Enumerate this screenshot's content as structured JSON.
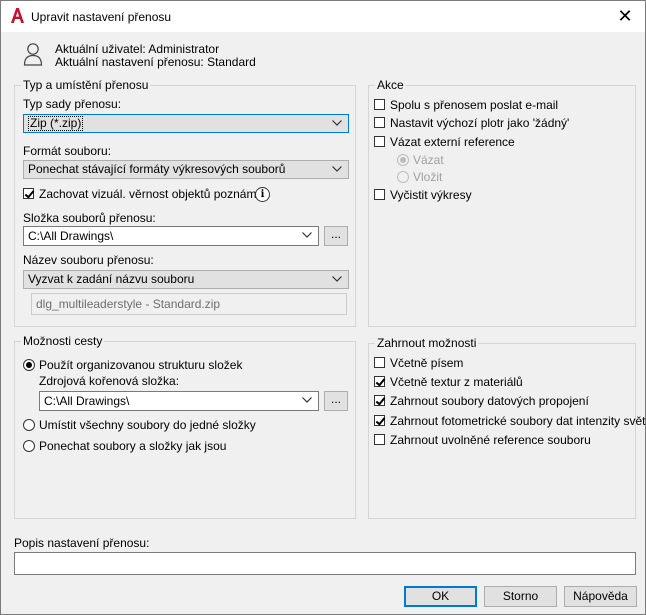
{
  "window": {
    "title": "Upravit nastavení přenosu",
    "close_glyph": "✕"
  },
  "header": {
    "user_line": "Aktuální uživatel: Administrator",
    "setup_line": "Aktuální nastavení přenosu: Standard"
  },
  "typ_group": {
    "legend": "Typ a umístění přenosu",
    "package_type_label": "Typ sady přenosu:",
    "package_type_value": "Zip (*.zip)",
    "file_format_label": "Formát souboru:",
    "file_format_value": "Ponechat stávající formáty výkresových souborů",
    "visual_fidelity_label": "Zachovat vizuál. věrnost objektů poznámek",
    "visual_fidelity_checked": true,
    "info_glyph": "i",
    "folder_label": "Složka souborů přenosu:",
    "folder_value": "C:\\All Drawings\\",
    "browse_label": "...",
    "filename_label": "Název souboru přenosu:",
    "filename_value": "Vyzvat k zadání názvu souboru",
    "filename_preview": "dlg_multileaderstyle - Standard.zip"
  },
  "path_group": {
    "legend": "Možnosti cesty",
    "organized_label": "Použít organizovanou strukturu složek",
    "root_label": "Zdrojová kořenová složka:",
    "root_value": "C:\\All Drawings\\",
    "browse_label": "...",
    "single_folder_label": "Umístit všechny soubory do jedné složky",
    "keep_as_is_label": "Ponechat soubory a složky jak jsou",
    "selected": "organized"
  },
  "actions_group": {
    "legend": "Akce",
    "email_label": "Spolu s přenosem poslat e-mail",
    "email_checked": false,
    "plotter_label": "Nastavit výchozí plotr jako 'žádný'",
    "plotter_checked": false,
    "bind_xref_label": "Vázat externí reference",
    "bind_xref_checked": false,
    "bind_label": "Vázat",
    "insert_label": "Vložit",
    "purge_label": "Vyčistit výkresy",
    "purge_checked": false
  },
  "include_group": {
    "legend": "Zahrnout možnosti",
    "fonts_label": "Včetně písem",
    "fonts_checked": false,
    "textures_label": "Včetně textur z materiálů",
    "textures_checked": true,
    "datalinks_label": "Zahrnout soubory datových propojení",
    "datalinks_checked": true,
    "photometric_label": "Zahrnout fotometrické soubory dat intenzity světla",
    "photometric_checked": true,
    "unloaded_label": "Zahrnout uvolněné reference souboru",
    "unloaded_checked": false
  },
  "description": {
    "label": "Popis nastavení přenosu:",
    "value": ""
  },
  "buttons": {
    "ok": "OK",
    "cancel": "Storno",
    "help": "Nápověda"
  },
  "colors": {
    "accent": "#0078d7",
    "autocad_red": "#c8102e"
  }
}
